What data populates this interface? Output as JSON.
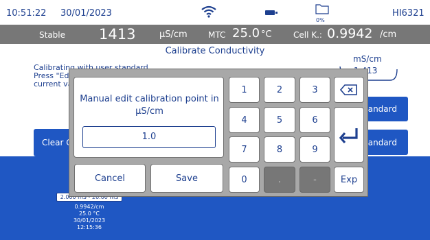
{
  "statusbar": {
    "time": "10:51:22",
    "date": "30/01/2023",
    "storage_percent": "0%",
    "model": "HI6321",
    "icons": [
      "wifi-icon",
      "battery-icon",
      "folder-icon"
    ]
  },
  "measurement": {
    "stability": "Stable",
    "value": "1413",
    "unit": "μS/cm",
    "temp_mode": "MTC",
    "temperature": "25.0",
    "temp_unit": "°C",
    "cell_k_label": "Cell K.:",
    "cell_k_value": "0.9942",
    "cell_k_unit": "/cm"
  },
  "screen": {
    "title": "Calibrate Conductivity",
    "instructions": [
      "Calibrating with user standard...",
      "Press \"Ed",
      "current va"
    ],
    "standard_unit": "mS/cm",
    "standard_value": "1.413",
    "clear_button_label": "Clear Ca",
    "standard_button_1": "andard",
    "standard_button_2": "Standard"
  },
  "calibration_info": {
    "range": "2.000 mS - 20.00 mS",
    "cell_constant": "0.9942/cm",
    "temperature": "25.0 °C",
    "date": "30/01/2023",
    "time": "12:15:36"
  },
  "dialog": {
    "label": "Manual edit calibration point in μS/cm",
    "input_value": "1.0",
    "cancel_label": "Cancel",
    "save_label": "Save",
    "keys": {
      "k1": "1",
      "k2": "2",
      "k3": "3",
      "k4": "4",
      "k5": "5",
      "k6": "6",
      "k7": "7",
      "k8": "8",
      "k9": "9",
      "k0": "0",
      "dot": ".",
      "minus": "-",
      "exp": "Exp"
    }
  },
  "colors": {
    "accent_blue": "#1f57c3",
    "text_navy": "#1d3f8f",
    "measure_bar_gray": "#777777",
    "dialog_gray": "#a8a8a8"
  }
}
